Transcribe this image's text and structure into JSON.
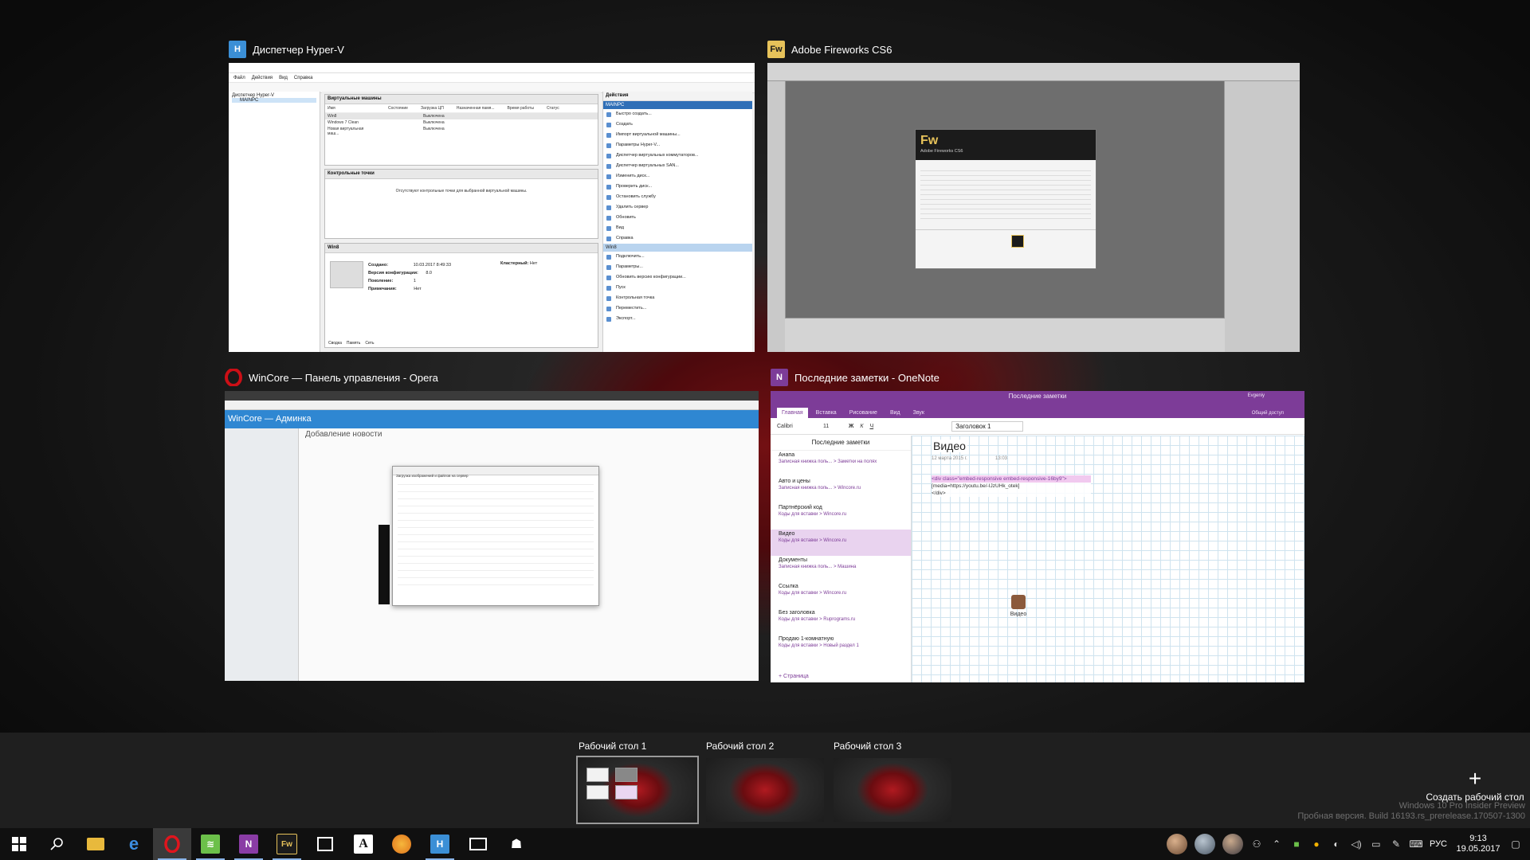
{
  "windows": {
    "hyperv": {
      "title": "Диспетчер Hyper-V",
      "menu": [
        "Файл",
        "Действия",
        "Вид",
        "Справка"
      ],
      "tree": [
        "Диспетчер Hyper-V",
        "MAINPC"
      ],
      "vm_panel_title": "Виртуальные машины",
      "vm_columns": [
        "Имя",
        "Состояние",
        "Загрузка ЦП",
        "Назначенная памя...",
        "Время работы",
        "Статус"
      ],
      "vms": [
        {
          "name": "Win8",
          "state": "Выключена"
        },
        {
          "name": "Windows 7 Clean",
          "state": "Выключена"
        },
        {
          "name": "Новая виртуальная маш...",
          "state": "Выключена"
        }
      ],
      "checkpoints_title": "Контрольные точки",
      "checkpoints_empty": "Отсутствуют контрольные точки для выбранной виртуальной машины.",
      "details_title": "Win8",
      "details": [
        {
          "k": "Создано:",
          "v": "10.03.2017 8:49:33"
        },
        {
          "k": "Версия конфигурации:",
          "v": "8.0"
        },
        {
          "k": "Поколение:",
          "v": "1"
        },
        {
          "k": "Примечания:",
          "v": "Нет"
        }
      ],
      "cluster_k": "Кластерный:",
      "cluster_v": "Нет",
      "detail_tabs": [
        "Сводка",
        "Память",
        "Сеть"
      ],
      "actions_title": "Действия",
      "actions_host": "MAINPC",
      "host_actions": [
        "Быстро создать...",
        "Создать",
        "Импорт виртуальной машины...",
        "Параметры Hyper-V...",
        "Диспетчер виртуальных коммутаторов...",
        "Диспетчер виртуальных SAN...",
        "Изменить диск...",
        "Проверить диск...",
        "Остановить службу",
        "Удалить сервер",
        "Обновить",
        "Вид",
        "Справка"
      ],
      "actions_vm": "Win8",
      "vm_actions": [
        "Подключить...",
        "Параметры...",
        "Обновить версию конфигурации...",
        "Пуск",
        "Контрольная точка",
        "Переместить...",
        "Экспорт..."
      ]
    },
    "fireworks": {
      "title": "Adobe Fireworks CS6",
      "logo": "Fw",
      "product": "Adobe Fireworks CS6"
    },
    "opera": {
      "title": "WinCore — Панель управления - Opera",
      "site_title": "WinCore — Админка",
      "page_heading": "Добавление новости",
      "dialog_title": "Загрузка изображений и файлов на сервер"
    },
    "onenote": {
      "title": "Последние заметки - OneNote",
      "window_caption": "Последние заметки",
      "user": "Evgeniy",
      "share": "Общий доступ",
      "ribbon_tabs": [
        "Главная",
        "Вставка",
        "Рисование",
        "Вид",
        "Звук"
      ],
      "font": "Calibri",
      "font_size": "11",
      "style": "Заголовок 1",
      "notebook": "Последние заметки",
      "pages": [
        {
          "title": "Анапа",
          "path": "Записная книжка поль... > Заметки на полях"
        },
        {
          "title": "Авто и цены",
          "path": "Записная книжка поль... > Wincore.ru"
        },
        {
          "title": "Партнёрский код",
          "path": "Коды для вставки > Wincore.ru"
        },
        {
          "title": "Видео",
          "path": "Коды для вставки > Wincore.ru"
        },
        {
          "title": "Документы",
          "path": "Записная книжка поль... > Машина"
        },
        {
          "title": "Ссылка",
          "path": "Коды для вставки > Wincore.ru"
        },
        {
          "title": "Без заголовка",
          "path": "Коды для вставки > Ruprograms.ru"
        },
        {
          "title": "Продаю 1-комнатную",
          "path": "Коды для вставки > Новый раздел 1"
        }
      ],
      "add_page": "Страница",
      "page_title": "Видео",
      "page_date": "12 марта 2015 г.",
      "page_time": "13:03",
      "code_lines": [
        "<div class=\"embed-responsive embed-responsive-16by9\">",
        "[media=https://youtu.be/-IJzUHk_otek]",
        "</div>"
      ],
      "attachment": "Видео"
    }
  },
  "desktops": [
    {
      "label": "Рабочий стол 1",
      "active": true
    },
    {
      "label": "Рабочий стол 2",
      "active": false
    },
    {
      "label": "Рабочий стол 3",
      "active": false
    }
  ],
  "new_desktop": "Создать рабочий стол",
  "watermark": {
    "line1": "Windows 10 Pro Insider Preview",
    "line2": "Пробная версия. Build 16193.rs_prerelease.170507-1300"
  },
  "taskbar": {
    "icons": [
      "start-icon",
      "search-icon",
      "file-explorer-icon",
      "edge-icon",
      "opera-icon",
      "feedly-icon",
      "onenote-icon",
      "fireworks-icon",
      "store-icon",
      "font-icon",
      "paint-icon",
      "hyperv-icon",
      "mail-icon",
      "people-icon"
    ],
    "lang": "РУС",
    "time": "9:13",
    "date": "19.05.2017"
  },
  "colors": {
    "onenote_purple": "#7d3c98",
    "opera_red": "#cc0f16",
    "fireworks_yellow": "#e6c25a",
    "hyperv_blue": "#2f6fb7"
  }
}
